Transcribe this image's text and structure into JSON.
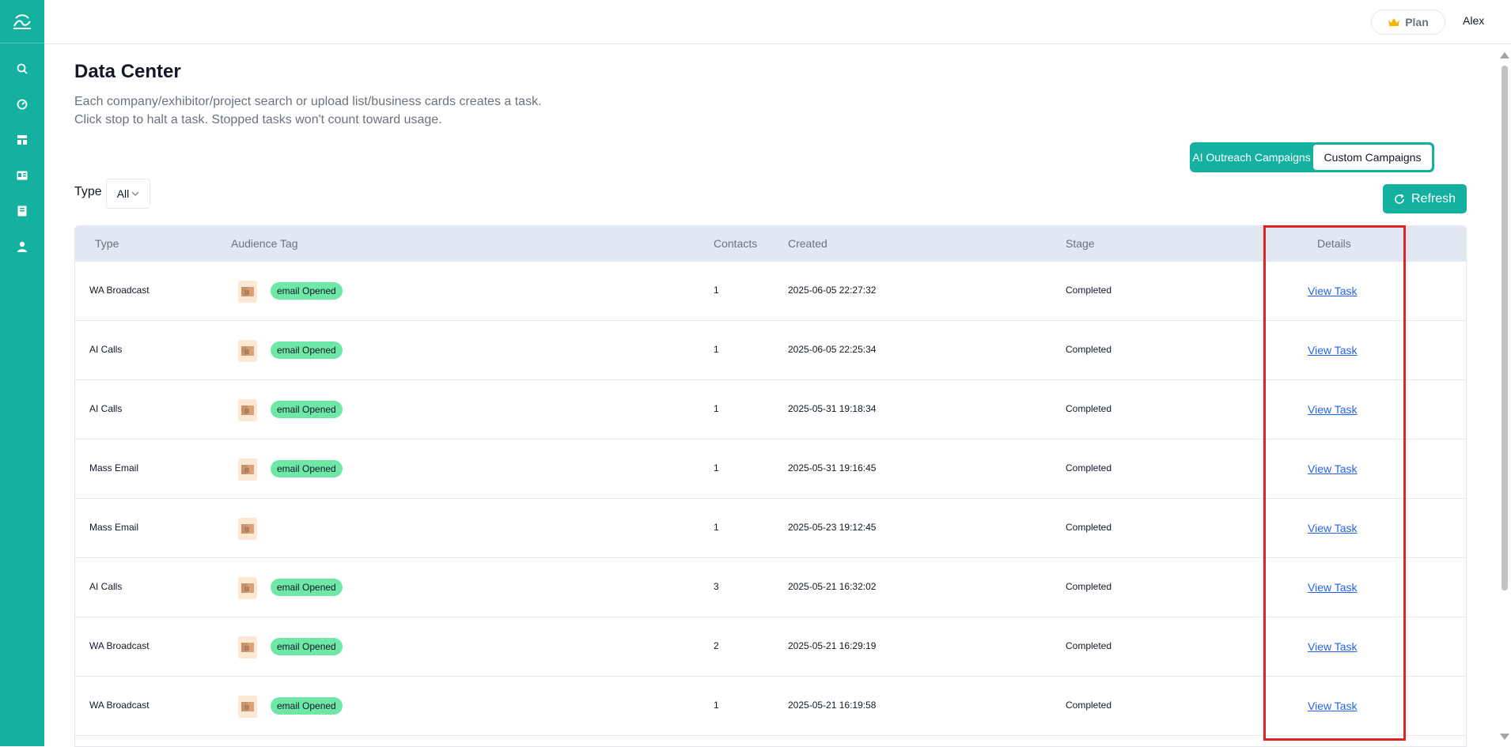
{
  "header": {
    "plan_label": "Plan",
    "user_name": "Alex"
  },
  "sidebar": {
    "items": [
      {
        "icon": "search-icon"
      },
      {
        "icon": "dashboard-icon"
      },
      {
        "icon": "layout-icon"
      },
      {
        "icon": "id-card-icon"
      },
      {
        "icon": "book-icon"
      },
      {
        "icon": "user-icon"
      }
    ]
  },
  "page": {
    "title": "Data Center",
    "desc_line1": "Each company/exhibitor/project search or upload list/business cards creates a task.",
    "desc_line2": "Click stop to halt a task. Stopped tasks won't count toward usage."
  },
  "campaign_toggle": {
    "ai": "AI Outreach Campaigns",
    "custom": "Custom Campaigns",
    "selected": "custom"
  },
  "filter": {
    "type_label": "Type",
    "type_value": "All"
  },
  "refresh_label": "Refresh",
  "table": {
    "headers": {
      "type": "Type",
      "tag": "Audience Tag",
      "contacts": "Contacts",
      "created": "Created",
      "stage": "Stage",
      "details": "Details"
    },
    "rows": [
      {
        "type": "WA Broadcast",
        "tag": "email Opened",
        "contacts": "1",
        "created": "2025-06-05 22:27:32",
        "stage": "Completed",
        "action": "View Task"
      },
      {
        "type": "AI Calls",
        "tag": "email Opened",
        "contacts": "1",
        "created": "2025-06-05 22:25:34",
        "stage": "Completed",
        "action": "View Task"
      },
      {
        "type": "AI Calls",
        "tag": "email Opened",
        "contacts": "1",
        "created": "2025-05-31 19:18:34",
        "stage": "Completed",
        "action": "View Task"
      },
      {
        "type": "Mass Email",
        "tag": "email Opened",
        "contacts": "1",
        "created": "2025-05-31 19:16:45",
        "stage": "Completed",
        "action": "View Task"
      },
      {
        "type": "Mass Email",
        "tag": "",
        "contacts": "1",
        "created": "2025-05-23 19:12:45",
        "stage": "Completed",
        "action": "View Task"
      },
      {
        "type": "AI Calls",
        "tag": "email Opened",
        "contacts": "3",
        "created": "2025-05-21 16:32:02",
        "stage": "Completed",
        "action": "View Task"
      },
      {
        "type": "WA Broadcast",
        "tag": "email Opened",
        "contacts": "2",
        "created": "2025-05-21 16:29:19",
        "stage": "Completed",
        "action": "View Task"
      },
      {
        "type": "WA Broadcast",
        "tag": "email Opened",
        "contacts": "1",
        "created": "2025-05-21 16:19:58",
        "stage": "Completed",
        "action": "View Task"
      }
    ]
  },
  "colors": {
    "brand": "#14b0a0",
    "tag_bg": "#6ee7a7",
    "link": "#2563eb",
    "highlight": "#e02424"
  }
}
